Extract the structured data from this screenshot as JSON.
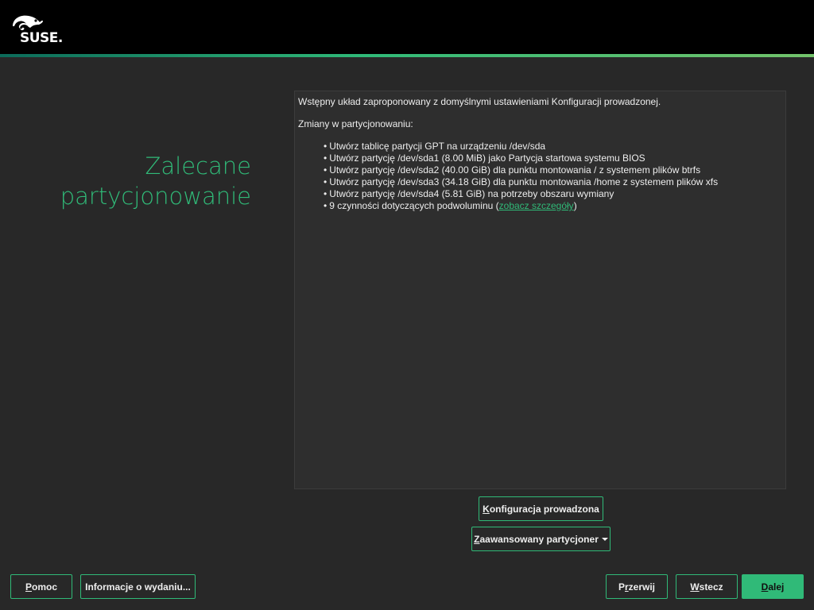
{
  "header": {
    "logo_text": "SUSE."
  },
  "page_title": {
    "line1": "Zalecane",
    "line2": "partycjonowanie"
  },
  "summary": {
    "intro": "Wstępny układ zaproponowany z domyślnymi ustawieniami Konfiguracji prowadzonej.",
    "changes_heading": "Zmiany w partycjonowaniu:",
    "items": [
      "Utwórz tablicę partycji GPT na urządzeniu /dev/sda",
      "Utwórz partycję /dev/sda1 (8.00 MiB) jako Partycja startowa systemu BIOS",
      "Utwórz partycję /dev/sda2 (40.00 GiB) dla punktu montowania / z systemem plików btrfs",
      "Utwórz partycję /dev/sda3 (34.18 GiB) dla punktu montowania /home z systemem plików xfs",
      "Utwórz partycję /dev/sda4 (5.81 GiB) na potrzeby obszaru wymiany"
    ],
    "subvolume_item_prefix": "9 czynności dotyczących podwoluminu (",
    "subvolume_item_link": "zobacz szczegóły",
    "subvolume_item_suffix": ")"
  },
  "buttons": {
    "guided_setup": {
      "mnemonic": "K",
      "rest": "onfiguracja prowadzona"
    },
    "expert_partitioner": {
      "mnemonic": "Z",
      "rest": "aawansowany partycjoner"
    },
    "help": {
      "mnemonic": "P",
      "rest": "omoc"
    },
    "release_notes": {
      "label": "Informacje o wydaniu..."
    },
    "abort": {
      "pre": "P",
      "mnemonic": "r",
      "rest": "zerwij"
    },
    "back": {
      "mnemonic": "W",
      "rest": "stecz"
    },
    "next": {
      "mnemonic": "D",
      "rest": "alej"
    }
  },
  "colors": {
    "accent": "#30ba78",
    "background": "#282828",
    "header": "#000000",
    "panel": "#2e2e2e"
  },
  "icons": {
    "logo": "suse-chameleon-logo",
    "expert_dropdown": "caret-down-icon"
  }
}
